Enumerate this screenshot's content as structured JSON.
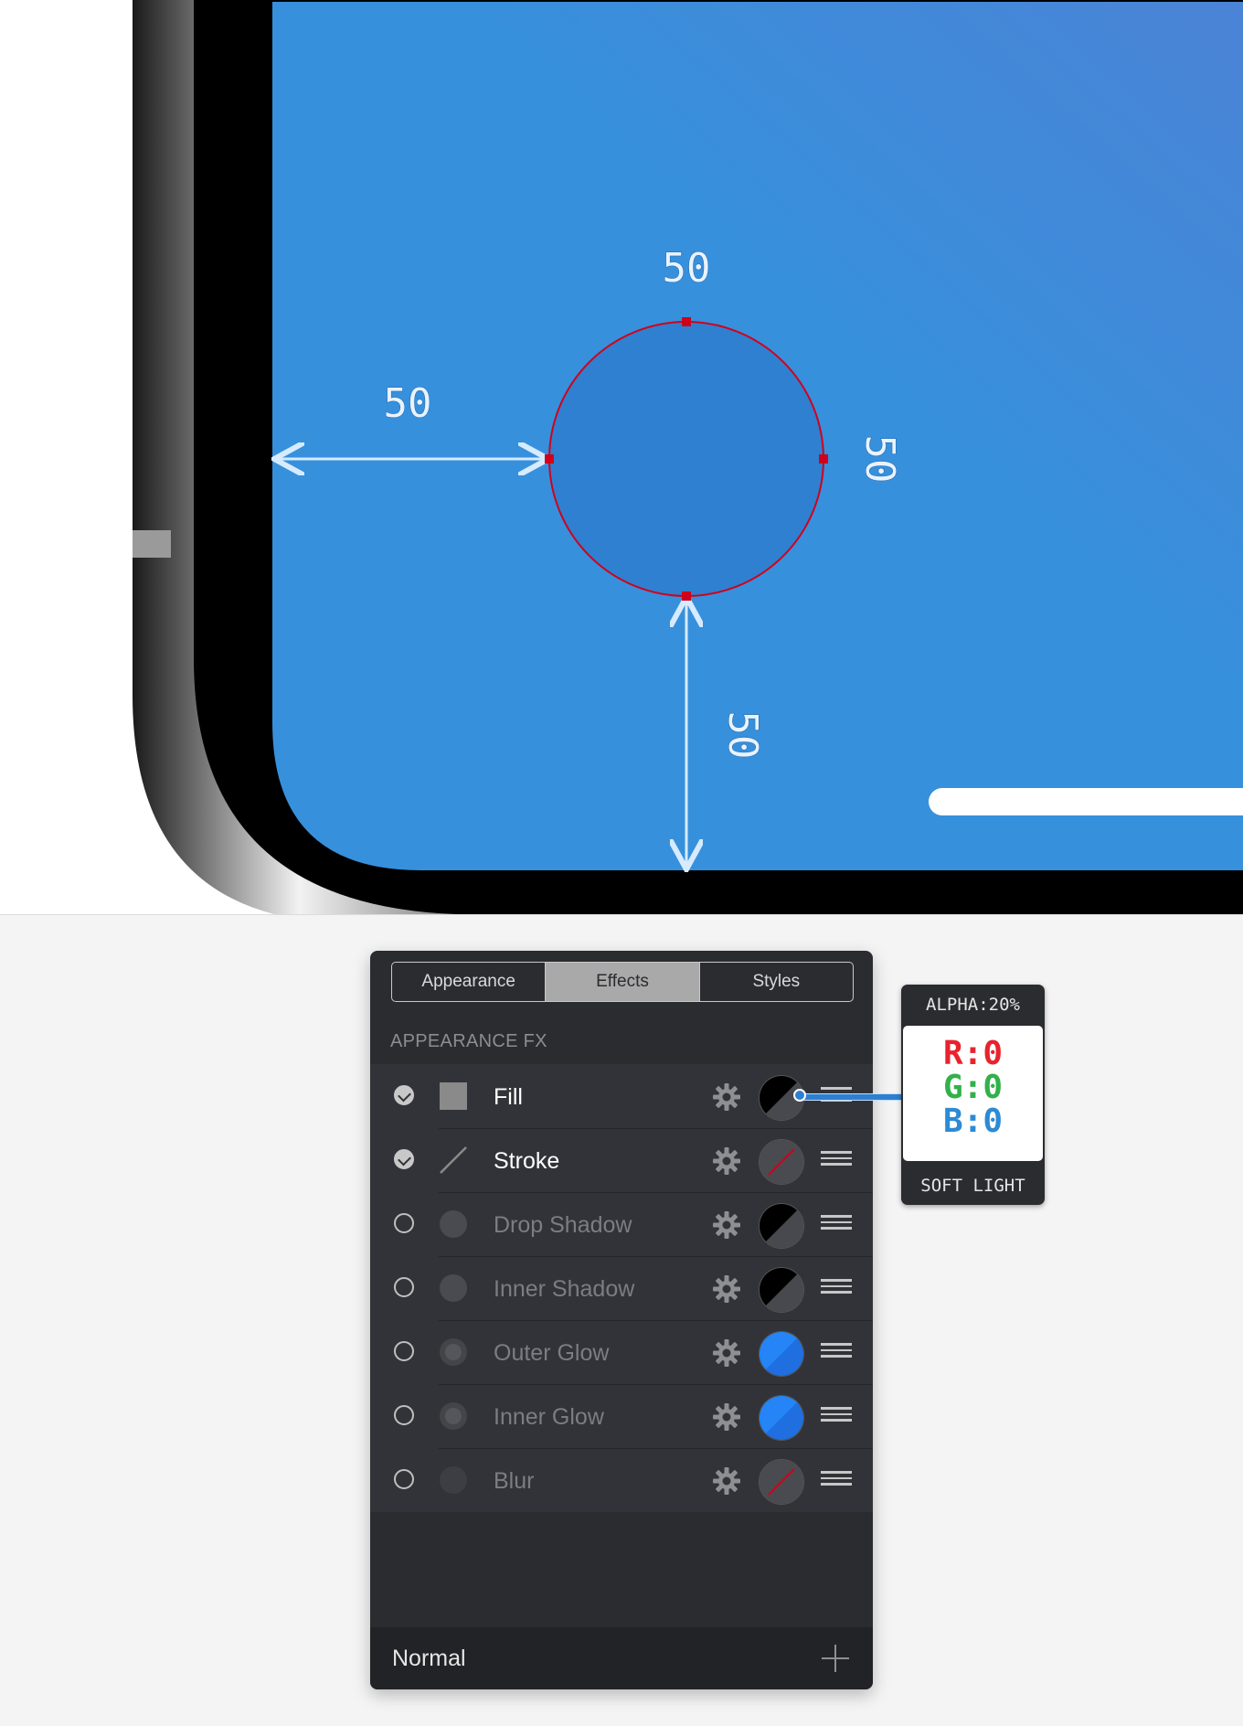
{
  "canvas": {
    "measurements": {
      "top": "50",
      "left": "50",
      "right": "50",
      "bottom": "50"
    },
    "colors": {
      "screen": "#3790dc",
      "circle": "#2f80d0",
      "outline": "#d0021b",
      "guide": "#d6ebff"
    }
  },
  "panel": {
    "tabs": [
      "Appearance",
      "Effects",
      "Styles"
    ],
    "active_tab": "Effects",
    "section_title": "APPEARANCE FX",
    "effects": [
      {
        "label": "Fill",
        "enabled": true,
        "type_icon": "square-icon",
        "swatch": "black-half"
      },
      {
        "label": "Stroke",
        "enabled": true,
        "type_icon": "line-icon",
        "swatch": "none-red-slash"
      },
      {
        "label": "Drop Shadow",
        "enabled": false,
        "type_icon": "shadow-dot-icon",
        "swatch": "black-half"
      },
      {
        "label": "Inner Shadow",
        "enabled": false,
        "type_icon": "shadow-dot-icon",
        "swatch": "black-half"
      },
      {
        "label": "Outer Glow",
        "enabled": false,
        "type_icon": "glow-dot-icon",
        "swatch": "blue-half"
      },
      {
        "label": "Inner Glow",
        "enabled": false,
        "type_icon": "glow-dot-icon",
        "swatch": "blue-half"
      },
      {
        "label": "Blur",
        "enabled": false,
        "type_icon": "blur-dot-icon",
        "swatch": "none-red-slash"
      }
    ],
    "footer": {
      "blend_mode": "Normal",
      "add_icon": "plus-icon"
    }
  },
  "tooltip": {
    "alpha": "ALPHA:20%",
    "r": "R:0",
    "g": "G:0",
    "b": "B:0",
    "blend": "SOFT LIGHT"
  }
}
